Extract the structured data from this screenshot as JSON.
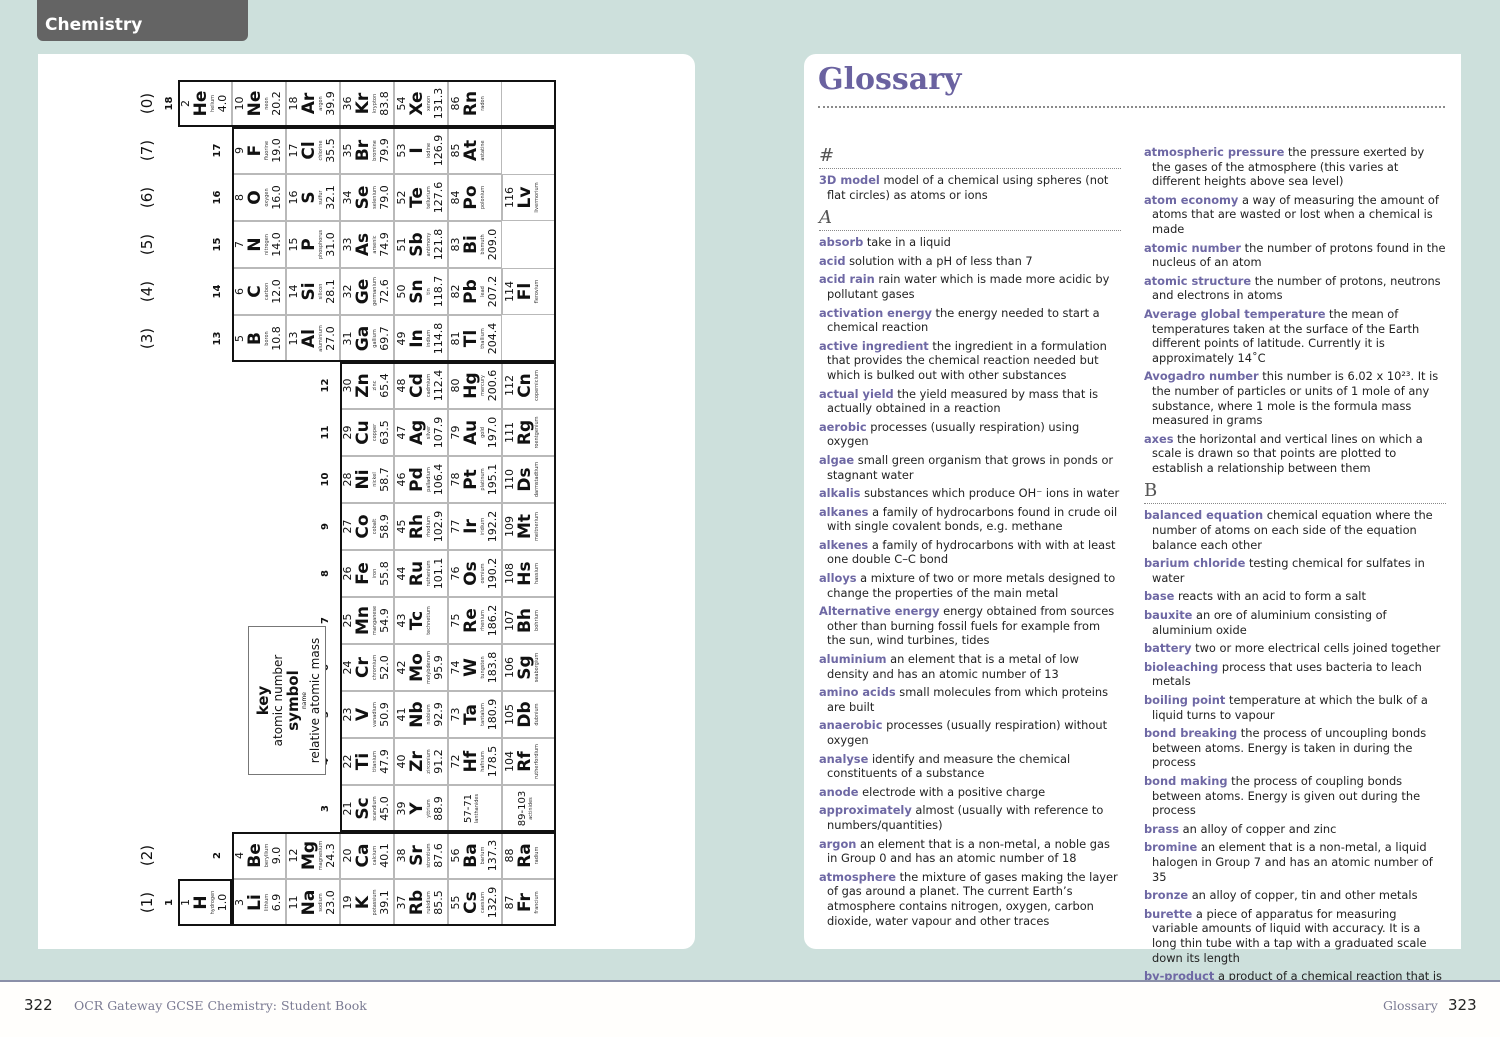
{
  "header": {
    "tab_label": "Chemistry"
  },
  "footer": {
    "left_page_number": "322",
    "left_text": "OCR Gateway GCSE Chemistry: Student Book",
    "right_text": "Glossary",
    "right_page_number": "323"
  },
  "periodic_table": {
    "group_labels": [
      "1",
      "2",
      "3",
      "4",
      "5",
      "6",
      "7",
      "8",
      "9",
      "10",
      "11",
      "12",
      "13",
      "14",
      "15",
      "16",
      "17",
      "18"
    ],
    "old_group_labels": {
      "1": "(1)",
      "2": "(2)",
      "13": "(3)",
      "14": "(4)",
      "15": "(5)",
      "16": "(6)",
      "17": "(7)",
      "18": "(0)"
    },
    "key": {
      "title": "key",
      "line1": "atomic number",
      "line2": "symbol",
      "line3": "name",
      "line4": "relative atomic mass"
    },
    "elements": [
      {
        "n": "1",
        "s": "H",
        "name": "hydrogen",
        "m": "1.0",
        "p": 1,
        "g": 1
      },
      {
        "n": "2",
        "s": "He",
        "name": "helium",
        "m": "4.0",
        "p": 1,
        "g": 18
      },
      {
        "n": "3",
        "s": "Li",
        "name": "lithium",
        "m": "6.9",
        "p": 2,
        "g": 1
      },
      {
        "n": "4",
        "s": "Be",
        "name": "beryllium",
        "m": "9.0",
        "p": 2,
        "g": 2
      },
      {
        "n": "5",
        "s": "B",
        "name": "boron",
        "m": "10.8",
        "p": 2,
        "g": 13
      },
      {
        "n": "6",
        "s": "C",
        "name": "carbon",
        "m": "12.0",
        "p": 2,
        "g": 14
      },
      {
        "n": "7",
        "s": "N",
        "name": "nitrogen",
        "m": "14.0",
        "p": 2,
        "g": 15
      },
      {
        "n": "8",
        "s": "O",
        "name": "oxygen",
        "m": "16.0",
        "p": 2,
        "g": 16
      },
      {
        "n": "9",
        "s": "F",
        "name": "fluorine",
        "m": "19.0",
        "p": 2,
        "g": 17
      },
      {
        "n": "10",
        "s": "Ne",
        "name": "neon",
        "m": "20.2",
        "p": 2,
        "g": 18
      },
      {
        "n": "11",
        "s": "Na",
        "name": "sodium",
        "m": "23.0",
        "p": 3,
        "g": 1
      },
      {
        "n": "12",
        "s": "Mg",
        "name": "magnesium",
        "m": "24.3",
        "p": 3,
        "g": 2
      },
      {
        "n": "13",
        "s": "Al",
        "name": "aluminium",
        "m": "27.0",
        "p": 3,
        "g": 13
      },
      {
        "n": "14",
        "s": "Si",
        "name": "silicon",
        "m": "28.1",
        "p": 3,
        "g": 14
      },
      {
        "n": "15",
        "s": "P",
        "name": "phosphorus",
        "m": "31.0",
        "p": 3,
        "g": 15
      },
      {
        "n": "16",
        "s": "S",
        "name": "sulfur",
        "m": "32.1",
        "p": 3,
        "g": 16
      },
      {
        "n": "17",
        "s": "Cl",
        "name": "chlorine",
        "m": "35.5",
        "p": 3,
        "g": 17
      },
      {
        "n": "18",
        "s": "Ar",
        "name": "argon",
        "m": "39.9",
        "p": 3,
        "g": 18
      },
      {
        "n": "19",
        "s": "K",
        "name": "potassium",
        "m": "39.1",
        "p": 4,
        "g": 1
      },
      {
        "n": "20",
        "s": "Ca",
        "name": "calcium",
        "m": "40.1",
        "p": 4,
        "g": 2
      },
      {
        "n": "21",
        "s": "Sc",
        "name": "scandium",
        "m": "45.0",
        "p": 4,
        "g": 3
      },
      {
        "n": "22",
        "s": "Ti",
        "name": "titanium",
        "m": "47.9",
        "p": 4,
        "g": 4
      },
      {
        "n": "23",
        "s": "V",
        "name": "vanadium",
        "m": "50.9",
        "p": 4,
        "g": 5
      },
      {
        "n": "24",
        "s": "Cr",
        "name": "chromium",
        "m": "52.0",
        "p": 4,
        "g": 6
      },
      {
        "n": "25",
        "s": "Mn",
        "name": "manganese",
        "m": "54.9",
        "p": 4,
        "g": 7
      },
      {
        "n": "26",
        "s": "Fe",
        "name": "iron",
        "m": "55.8",
        "p": 4,
        "g": 8
      },
      {
        "n": "27",
        "s": "Co",
        "name": "cobalt",
        "m": "58.9",
        "p": 4,
        "g": 9
      },
      {
        "n": "28",
        "s": "Ni",
        "name": "nickel",
        "m": "58.7",
        "p": 4,
        "g": 10
      },
      {
        "n": "29",
        "s": "Cu",
        "name": "copper",
        "m": "63.5",
        "p": 4,
        "g": 11
      },
      {
        "n": "30",
        "s": "Zn",
        "name": "zinc",
        "m": "65.4",
        "p": 4,
        "g": 12
      },
      {
        "n": "31",
        "s": "Ga",
        "name": "gallium",
        "m": "69.7",
        "p": 4,
        "g": 13
      },
      {
        "n": "32",
        "s": "Ge",
        "name": "germanium",
        "m": "72.6",
        "p": 4,
        "g": 14
      },
      {
        "n": "33",
        "s": "As",
        "name": "arsenic",
        "m": "74.9",
        "p": 4,
        "g": 15
      },
      {
        "n": "34",
        "s": "Se",
        "name": "selenium",
        "m": "79.0",
        "p": 4,
        "g": 16
      },
      {
        "n": "35",
        "s": "Br",
        "name": "bromine",
        "m": "79.9",
        "p": 4,
        "g": 17
      },
      {
        "n": "36",
        "s": "Kr",
        "name": "krypton",
        "m": "83.8",
        "p": 4,
        "g": 18
      },
      {
        "n": "37",
        "s": "Rb",
        "name": "rubidium",
        "m": "85.5",
        "p": 5,
        "g": 1
      },
      {
        "n": "38",
        "s": "Sr",
        "name": "strontium",
        "m": "87.6",
        "p": 5,
        "g": 2
      },
      {
        "n": "39",
        "s": "Y",
        "name": "yttrium",
        "m": "88.9",
        "p": 5,
        "g": 3
      },
      {
        "n": "40",
        "s": "Zr",
        "name": "zirconium",
        "m": "91.2",
        "p": 5,
        "g": 4
      },
      {
        "n": "41",
        "s": "Nb",
        "name": "niobium",
        "m": "92.9",
        "p": 5,
        "g": 5
      },
      {
        "n": "42",
        "s": "Mo",
        "name": "molybdenum",
        "m": "95.9",
        "p": 5,
        "g": 6
      },
      {
        "n": "43",
        "s": "Tc",
        "name": "technetium",
        "m": "",
        "p": 5,
        "g": 7
      },
      {
        "n": "44",
        "s": "Ru",
        "name": "ruthenium",
        "m": "101.1",
        "p": 5,
        "g": 8
      },
      {
        "n": "45",
        "s": "Rh",
        "name": "rhodium",
        "m": "102.9",
        "p": 5,
        "g": 9
      },
      {
        "n": "46",
        "s": "Pd",
        "name": "palladium",
        "m": "106.4",
        "p": 5,
        "g": 10
      },
      {
        "n": "47",
        "s": "Ag",
        "name": "silver",
        "m": "107.9",
        "p": 5,
        "g": 11
      },
      {
        "n": "48",
        "s": "Cd",
        "name": "cadmium",
        "m": "112.4",
        "p": 5,
        "g": 12
      },
      {
        "n": "49",
        "s": "In",
        "name": "indium",
        "m": "114.8",
        "p": 5,
        "g": 13
      },
      {
        "n": "50",
        "s": "Sn",
        "name": "tin",
        "m": "118.7",
        "p": 5,
        "g": 14
      },
      {
        "n": "51",
        "s": "Sb",
        "name": "antimony",
        "m": "121.8",
        "p": 5,
        "g": 15
      },
      {
        "n": "52",
        "s": "Te",
        "name": "tellurium",
        "m": "127.6",
        "p": 5,
        "g": 16
      },
      {
        "n": "53",
        "s": "I",
        "name": "iodine",
        "m": "126.9",
        "p": 5,
        "g": 17
      },
      {
        "n": "54",
        "s": "Xe",
        "name": "xenon",
        "m": "131.3",
        "p": 5,
        "g": 18
      },
      {
        "n": "55",
        "s": "Cs",
        "name": "caesium",
        "m": "132.9",
        "p": 6,
        "g": 1
      },
      {
        "n": "56",
        "s": "Ba",
        "name": "barium",
        "m": "137.3",
        "p": 6,
        "g": 2
      },
      {
        "n": "72",
        "s": "Hf",
        "name": "hafnium",
        "m": "178.5",
        "p": 6,
        "g": 4
      },
      {
        "n": "73",
        "s": "Ta",
        "name": "tantalum",
        "m": "180.9",
        "p": 6,
        "g": 5
      },
      {
        "n": "74",
        "s": "W",
        "name": "tungsten",
        "m": "183.8",
        "p": 6,
        "g": 6
      },
      {
        "n": "75",
        "s": "Re",
        "name": "rhenium",
        "m": "186.2",
        "p": 6,
        "g": 7
      },
      {
        "n": "76",
        "s": "Os",
        "name": "osmium",
        "m": "190.2",
        "p": 6,
        "g": 8
      },
      {
        "n": "77",
        "s": "Ir",
        "name": "iridium",
        "m": "192.2",
        "p": 6,
        "g": 9
      },
      {
        "n": "78",
        "s": "Pt",
        "name": "platinum",
        "m": "195.1",
        "p": 6,
        "g": 10
      },
      {
        "n": "79",
        "s": "Au",
        "name": "gold",
        "m": "197.0",
        "p": 6,
        "g": 11
      },
      {
        "n": "80",
        "s": "Hg",
        "name": "mercury",
        "m": "200.6",
        "p": 6,
        "g": 12
      },
      {
        "n": "81",
        "s": "Tl",
        "name": "thallium",
        "m": "204.4",
        "p": 6,
        "g": 13
      },
      {
        "n": "82",
        "s": "Pb",
        "name": "lead",
        "m": "207.2",
        "p": 6,
        "g": 14
      },
      {
        "n": "83",
        "s": "Bi",
        "name": "bismuth",
        "m": "209.0",
        "p": 6,
        "g": 15
      },
      {
        "n": "84",
        "s": "Po",
        "name": "polonium",
        "m": "",
        "p": 6,
        "g": 16
      },
      {
        "n": "85",
        "s": "At",
        "name": "astatine",
        "m": "",
        "p": 6,
        "g": 17
      },
      {
        "n": "86",
        "s": "Rn",
        "name": "radon",
        "m": "",
        "p": 6,
        "g": 18
      },
      {
        "n": "87",
        "s": "Fr",
        "name": "francium",
        "m": "",
        "p": 7,
        "g": 1
      },
      {
        "n": "88",
        "s": "Ra",
        "name": "radium",
        "m": "",
        "p": 7,
        "g": 2
      },
      {
        "n": "104",
        "s": "Rf",
        "name": "rutherfordium",
        "m": "",
        "p": 7,
        "g": 4
      },
      {
        "n": "105",
        "s": "Db",
        "name": "dubnium",
        "m": "",
        "p": 7,
        "g": 5
      },
      {
        "n": "106",
        "s": "Sg",
        "name": "seaborgium",
        "m": "",
        "p": 7,
        "g": 6
      },
      {
        "n": "107",
        "s": "Bh",
        "name": "bohrium",
        "m": "",
        "p": 7,
        "g": 7
      },
      {
        "n": "108",
        "s": "Hs",
        "name": "hassium",
        "m": "",
        "p": 7,
        "g": 8
      },
      {
        "n": "109",
        "s": "Mt",
        "name": "meitnerium",
        "m": "",
        "p": 7,
        "g": 9
      },
      {
        "n": "110",
        "s": "Ds",
        "name": "darmstadtium",
        "m": "",
        "p": 7,
        "g": 10
      },
      {
        "n": "111",
        "s": "Rg",
        "name": "roentgenium",
        "m": "",
        "p": 7,
        "g": 11
      },
      {
        "n": "112",
        "s": "Cn",
        "name": "copernicium",
        "m": "",
        "p": 7,
        "g": 12
      },
      {
        "n": "114",
        "s": "Fl",
        "name": "flerovium",
        "m": "",
        "p": 7,
        "g": 14
      },
      {
        "n": "116",
        "s": "Lv",
        "name": "livermorium",
        "m": "",
        "p": 7,
        "g": 16
      }
    ],
    "blocks": [
      {
        "range": "57-71",
        "label": "lanthanides",
        "p": 6,
        "g": 3
      },
      {
        "range": "89-103",
        "label": "actinides",
        "p": 7,
        "g": 3
      }
    ]
  },
  "glossary": {
    "title": "Glossary",
    "columns": [
      [
        {
          "heading": "#"
        },
        {
          "term": "3D model",
          "def": "model of a chemical using spheres (not flat circles) as atoms or ions"
        },
        {
          "heading": "A"
        },
        {
          "term": "absorb",
          "def": "take in a liquid"
        },
        {
          "term": "acid",
          "def": "solution with a pH of less than 7"
        },
        {
          "term": "acid rain",
          "def": "rain water which is made more acidic by pollutant gases"
        },
        {
          "term": "activation energy",
          "def": "the energy needed to start a chemical reaction"
        },
        {
          "term": "active ingredient",
          "def": "the ingredient in a formulation that provides the chemical reaction needed but which is bulked out with other substances"
        },
        {
          "term": "actual yield",
          "def": "the yield measured by mass that is actually obtained in a reaction"
        },
        {
          "term": "aerobic",
          "def": "processes (usually respiration) using oxygen"
        },
        {
          "term": "algae",
          "def": "small green organism that grows in ponds or stagnant water"
        },
        {
          "term": "alkalis",
          "def": "substances which produce OH⁻ ions in water"
        },
        {
          "term": "alkanes",
          "def": "a family of hydrocarbons found in crude oil with single covalent bonds, e.g. methane"
        },
        {
          "term": "alkenes",
          "def": "a family of hydrocarbons with with at least one double C–C bond"
        },
        {
          "term": "alloys",
          "def": "a mixture of two or more metals designed to change the properties of the main metal"
        },
        {
          "term": "Alternative energy",
          "def": "energy obtained from sources other than burning fossil fuels for example from the sun, wind turbines, tides"
        },
        {
          "term": "aluminium",
          "def": "an element that is a metal of low density and has an atomic number of 13"
        },
        {
          "term": "amino acids",
          "def": "small molecules from which proteins are built"
        },
        {
          "term": "anaerobic",
          "def": "processes (usually respiration) without oxygen"
        },
        {
          "term": "analyse",
          "def": "identify and measure the chemical constituents of a substance"
        },
        {
          "term": "anode",
          "def": "electrode with a positive charge"
        },
        {
          "term": "approximately",
          "def": "almost (usually with reference to numbers/quantities)"
        },
        {
          "term": "argon",
          "def": "an element that is a non-metal, a noble gas in Group 0 and has an atomic number of 18"
        },
        {
          "term": "atmosphere",
          "def": "the mixture of gases making the layer of gas around a planet. The current Earth’s atmosphere contains nitrogen, oxygen, carbon dioxide, water vapour and other traces"
        }
      ],
      [
        {
          "term": "atmospheric pressure",
          "def": "the pressure exerted by the gases of the atmosphere (this varies at different heights above sea level)"
        },
        {
          "term": "atom economy",
          "def": "a way of measuring the amount of atoms that are wasted or lost when a chemical is made"
        },
        {
          "term": "atomic number",
          "def": "the number of protons found in the nucleus of an atom"
        },
        {
          "term": "atomic structure",
          "def": "the number of protons, neutrons and electrons in atoms"
        },
        {
          "term": "Average global temperature",
          "def": "the mean of temperatures taken at the surface of the Earth different points of latitude. Currently it is approximately 14˚C"
        },
        {
          "term": "Avogadro number",
          "def": "this number is 6.02 x 10²³. It is the number of particles or units of 1 mole of any substance, where 1 mole is the formula mass measured in grams"
        },
        {
          "term": "axes",
          "def": "the horizontal and vertical lines on which a scale is drawn so that points are plotted to establish a relationship between them"
        },
        {
          "heading": "B"
        },
        {
          "term": "balanced equation",
          "def": "chemical equation where the number of atoms on each side of the equation balance each other"
        },
        {
          "term": "barium chloride",
          "def": "testing chemical for sulfates in water"
        },
        {
          "term": "base",
          "def": "reacts with an acid to form a salt"
        },
        {
          "term": "bauxite",
          "def": "an ore of aluminium consisting of aluminium oxide"
        },
        {
          "term": "battery",
          "def": "two or more electrical cells joined together"
        },
        {
          "term": "bioleaching",
          "def": "process that uses bacteria to leach metals"
        },
        {
          "term": "boiling point",
          "def": "temperature at which the bulk of a liquid turns to vapour"
        },
        {
          "term": "bond breaking",
          "def": "the process of uncoupling bonds between atoms. Energy is taken in during the process"
        },
        {
          "term": "bond making",
          "def": "the process of coupling bonds between atoms. Energy is given out during the process"
        },
        {
          "term": "brass",
          "def": "an alloy of copper and zinc"
        },
        {
          "term": "bromine",
          "def": "an element that is a non-metal, a liquid halogen in Group 7 and has an atomic number of 35"
        },
        {
          "term": "bronze",
          "def": "an alloy of copper, tin and other metals"
        },
        {
          "term": "burette",
          "def": "a piece of apparatus for measuring variable amounts of liquid with accuracy. It is a long thin tube with a tap with a graduated scale down its length"
        },
        {
          "term": "by-product",
          "def": "a product of a chemical reaction that is not the required product"
        }
      ]
    ]
  }
}
